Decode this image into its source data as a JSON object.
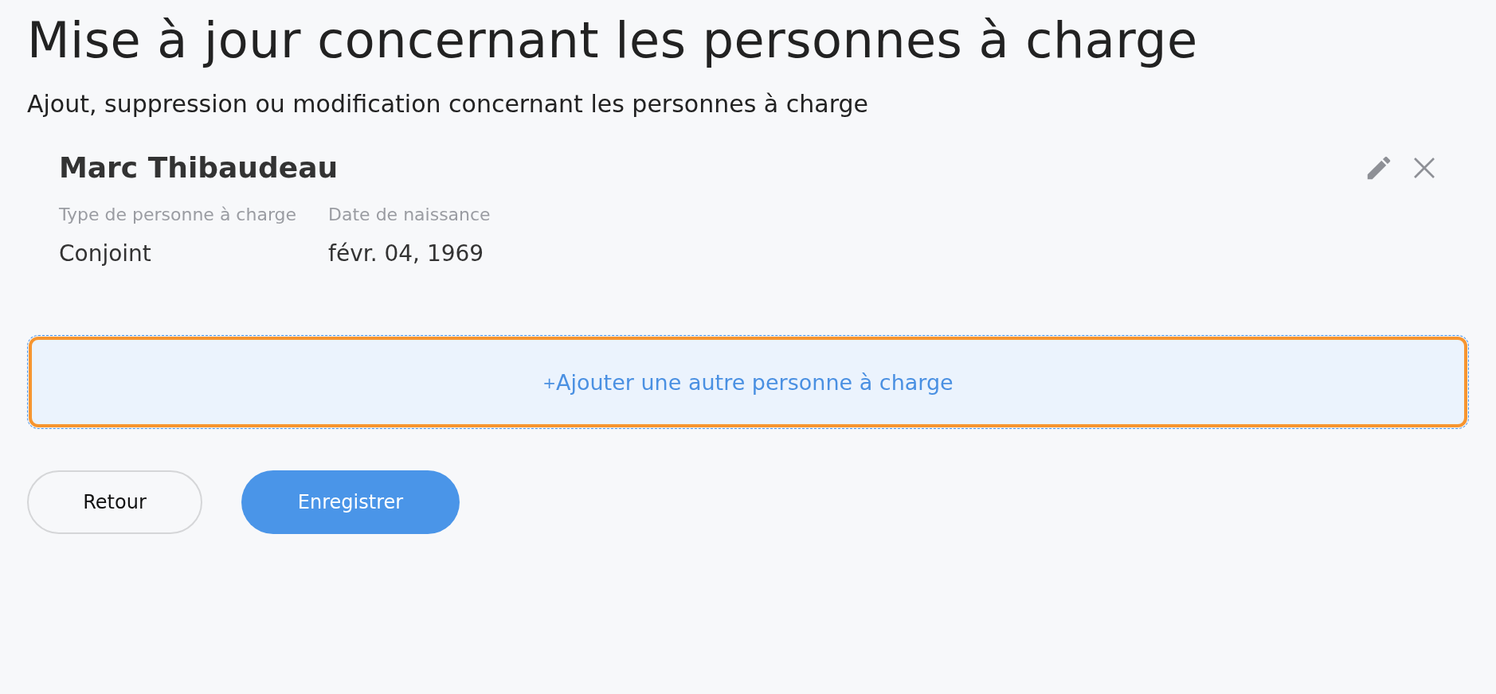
{
  "title": "Mise à jour concernant les personnes à charge",
  "subtitle": "Ajout, suppression ou modification concernant les personnes à charge",
  "dependents": [
    {
      "name": "Marc Thibaudeau",
      "fields": [
        {
          "label": "Type de personne à charge",
          "value": "Conjoint"
        },
        {
          "label": "Date de naissance",
          "value": "févr. 04, 1969"
        }
      ]
    }
  ],
  "add_button": {
    "icon": "+",
    "label": "Ajouter une autre personne à charge",
    "focused": true
  },
  "buttons": [
    {
      "label": "Retour",
      "kind": "secondary"
    },
    {
      "label": "Enregistrer",
      "kind": "primary"
    }
  ]
}
